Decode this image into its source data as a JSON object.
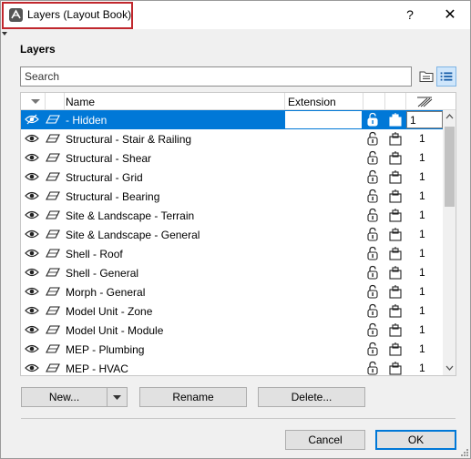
{
  "window": {
    "title": "Layers (Layout Book)",
    "help_label": "?",
    "close_label": "✕"
  },
  "section_title": "Layers",
  "search": {
    "placeholder": "Search",
    "value": ""
  },
  "columns": {
    "name": "Name",
    "extension": "Extension"
  },
  "layers": [
    {
      "name": "- Hidden",
      "pen": "1",
      "selected": true,
      "visible": false
    },
    {
      "name": "Structural - Stair & Railing",
      "pen": "1"
    },
    {
      "name": "Structural - Shear",
      "pen": "1"
    },
    {
      "name": "Structural - Grid",
      "pen": "1"
    },
    {
      "name": "Structural - Bearing",
      "pen": "1"
    },
    {
      "name": "Site & Landscape - Terrain",
      "pen": "1"
    },
    {
      "name": "Site & Landscape - General",
      "pen": "1"
    },
    {
      "name": "Shell - Roof",
      "pen": "1"
    },
    {
      "name": "Shell - General",
      "pen": "1"
    },
    {
      "name": "Morph - General",
      "pen": "1"
    },
    {
      "name": "Model Unit - Zone",
      "pen": "1"
    },
    {
      "name": "Model Unit - Module",
      "pen": "1"
    },
    {
      "name": "MEP - Plumbing",
      "pen": "1"
    },
    {
      "name": "MEP - HVAC",
      "pen": "1"
    }
  ],
  "buttons": {
    "new": "New...",
    "rename": "Rename",
    "delete": "Delete...",
    "cancel": "Cancel",
    "ok": "OK"
  },
  "colors": {
    "selection": "#0078d7",
    "title_highlight": "#c0272d"
  },
  "icons": [
    "eye-icon",
    "layer-icon",
    "lock-icon",
    "teamwork-icon",
    "pen-weight-icon",
    "folder-view-icon",
    "list-view-icon"
  ]
}
